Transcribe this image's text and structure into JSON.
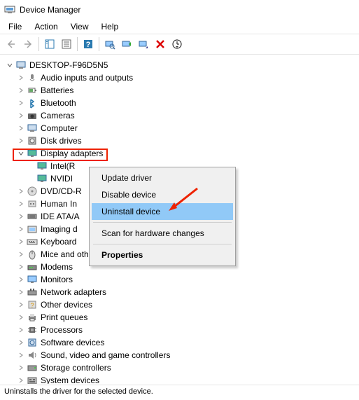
{
  "window": {
    "title": "Device Manager"
  },
  "menu": {
    "file": "File",
    "action": "Action",
    "view": "View",
    "help": "Help"
  },
  "tree": {
    "root": "DESKTOP-F96D5N5",
    "categories": [
      {
        "label": "Audio inputs and outputs",
        "icon": "audio"
      },
      {
        "label": "Batteries",
        "icon": "battery"
      },
      {
        "label": "Bluetooth",
        "icon": "bluetooth"
      },
      {
        "label": "Cameras",
        "icon": "camera"
      },
      {
        "label": "Computer",
        "icon": "computer"
      },
      {
        "label": "Disk drives",
        "icon": "disk"
      },
      {
        "label": "Display adapters",
        "icon": "display",
        "expanded": true,
        "highlighted": true,
        "children": [
          {
            "label": "Intel(R",
            "icon": "display"
          },
          {
            "label": "NVIDI",
            "icon": "display"
          }
        ]
      },
      {
        "label": "DVD/CD-R",
        "icon": "dvd"
      },
      {
        "label": "Human In",
        "icon": "hid"
      },
      {
        "label": "IDE ATA/A",
        "icon": "ide"
      },
      {
        "label": "Imaging d",
        "icon": "imaging"
      },
      {
        "label": "Keyboard",
        "icon": "keyboard"
      },
      {
        "label": "Mice and other pointing devices",
        "icon": "mouse"
      },
      {
        "label": "Modems",
        "icon": "modem"
      },
      {
        "label": "Monitors",
        "icon": "monitor"
      },
      {
        "label": "Network adapters",
        "icon": "network"
      },
      {
        "label": "Other devices",
        "icon": "other"
      },
      {
        "label": "Print queues",
        "icon": "printer"
      },
      {
        "label": "Processors",
        "icon": "processor"
      },
      {
        "label": "Software devices",
        "icon": "software"
      },
      {
        "label": "Sound, video and game controllers",
        "icon": "sound"
      },
      {
        "label": "Storage controllers",
        "icon": "storage"
      },
      {
        "label": "System devices",
        "icon": "system"
      }
    ]
  },
  "context_menu": {
    "update": "Update driver",
    "disable": "Disable device",
    "uninstall": "Uninstall device",
    "scan": "Scan for hardware changes",
    "properties": "Properties"
  },
  "statusbar": {
    "text": "Uninstalls the driver for the selected device."
  }
}
